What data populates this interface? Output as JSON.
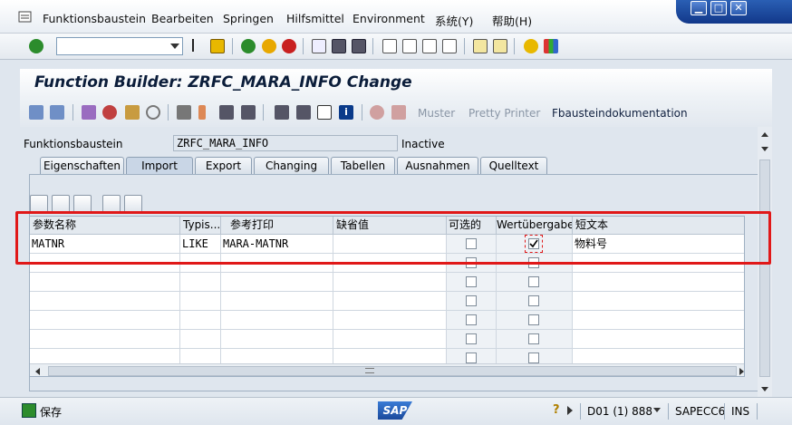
{
  "menubar": {
    "items": [
      {
        "label": "Funktionsbaustein",
        "u": "F"
      },
      {
        "label": "Bearbeiten",
        "u": "B"
      },
      {
        "label": "Springen",
        "u": "S"
      },
      {
        "label": "Hilfsmittel",
        "u": ""
      },
      {
        "label": "Environment",
        "u": ""
      },
      {
        "label": "系统(Y)",
        "u": ""
      },
      {
        "label": "帮助(H)",
        "u": ""
      }
    ]
  },
  "window_controls": {
    "minimize": "▁",
    "maximize": "□",
    "close": "✕"
  },
  "system_toolbar": {
    "command_field_value": ""
  },
  "title": "Function Builder: ZRFC_MARA_INFO Change",
  "app_toolbar": {
    "muster": "Muster",
    "pretty_printer": "Pretty Printer",
    "fbaustein_doku": "Fbausteindokumentation"
  },
  "header": {
    "label": "Funktionsbaustein",
    "value": "ZRFC_MARA_INFO",
    "status": "Inactive"
  },
  "tabs": [
    {
      "label": "Eigenschaften",
      "active": false
    },
    {
      "label": "Import",
      "active": true
    },
    {
      "label": "Export",
      "active": false
    },
    {
      "label": "Changing",
      "active": false
    },
    {
      "label": "Tabellen",
      "active": false
    },
    {
      "label": "Ausnahmen",
      "active": false
    },
    {
      "label": "Quelltext",
      "active": false
    }
  ],
  "grid": {
    "columns": [
      "参数名称",
      "Typis...",
      "参考打印",
      "缺省值",
      "可选的",
      "Wertübergabe",
      "短文本"
    ],
    "rows": [
      {
        "name": "MATNR",
        "typing": "LIKE",
        "ref": "MARA-MATNR",
        "default": "",
        "optional": false,
        "pass_by_value": true,
        "short_text": "物料号"
      }
    ],
    "empty_row_count": 7
  },
  "statusbar": {
    "save_label": "保存",
    "system_info": "D01 (1) 888",
    "server": "SAPECC6",
    "mode": "INS",
    "sap_logo": "SAP"
  },
  "colors": {
    "highlight": "#e01818",
    "accent": "#12388a"
  }
}
